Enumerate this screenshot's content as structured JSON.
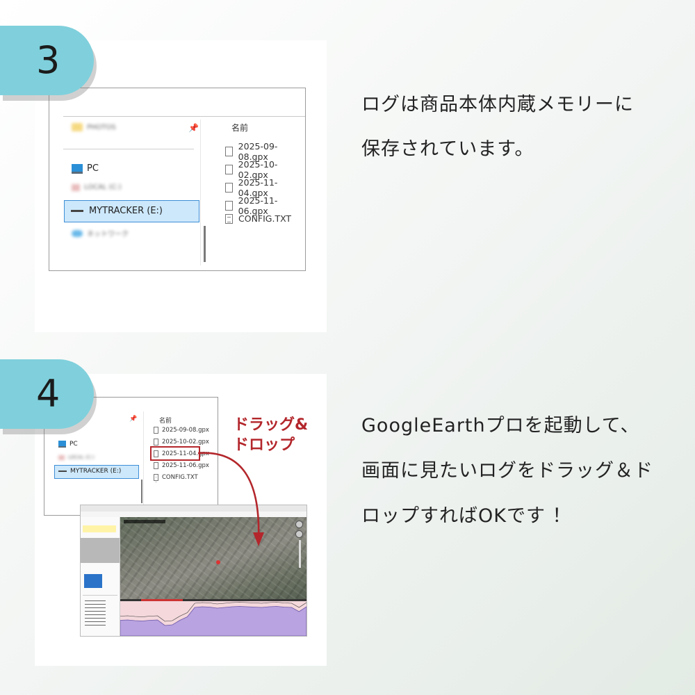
{
  "steps": [
    {
      "number": "3",
      "description_lines": [
        "ログは商品本体内蔵メモリーに",
        "保存されています。"
      ],
      "explorer": {
        "header": "名前",
        "nav": {
          "blurred_folder": "PHOTOS",
          "pc": "PC",
          "blurred_disk": "LOCAL (C:)",
          "drive": "MYTRACKER (E:)",
          "blurred_network": "ネットワーク"
        },
        "files": [
          "2025-09-08.gpx",
          "2025-10-02.gpx",
          "2025-11-04.gpx",
          "2025-11-06.gpx",
          "CONFIG.TXT"
        ]
      }
    },
    {
      "number": "4",
      "description_lines": [
        "GoogleEarthプロを起動して、",
        "画面に見たいログをドラッグ＆ド",
        "ロップすればOKです ！"
      ],
      "drag_drop_label": [
        "ドラッグ&",
        "ドロップ"
      ],
      "explorer": {
        "header": "名前",
        "nav": {
          "pc": "PC",
          "blurred_disk": "LOCAL (C:)",
          "drive": "MYTRACKER (E:)"
        },
        "files": [
          "2025-09-08.gpx",
          "2025-10-02.gpx",
          "2025-11-04.gpx",
          "2025-11-06.gpx",
          "CONFIG.TXT"
        ],
        "highlighted_file_index": 2
      },
      "google_earth": {
        "elevation_profile": [
          0.45,
          0.46,
          0.44,
          0.43,
          0.45,
          0.46,
          0.3,
          0.32,
          0.45,
          0.55,
          0.82,
          0.84,
          0.83,
          0.8,
          0.82,
          0.84,
          0.85,
          0.84,
          0.83,
          0.82,
          0.84,
          0.85,
          0.83,
          0.82,
          0.7,
          0.84
        ]
      }
    }
  ],
  "colors": {
    "tab": "#7fd0dc",
    "accent_red": "#b3262b",
    "selection": "#cde8fb"
  }
}
